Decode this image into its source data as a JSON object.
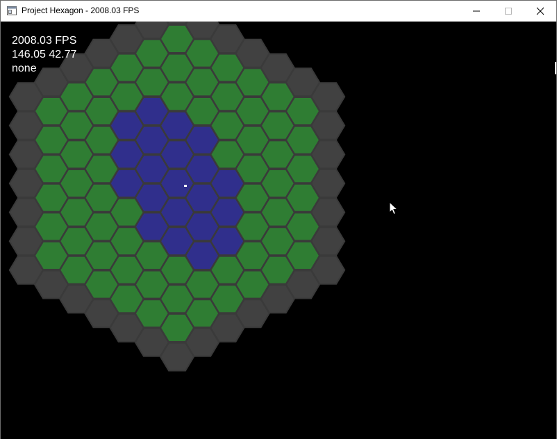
{
  "window": {
    "title": "Project Hexagon - 2008.03 FPS",
    "icon": "app-window-icon",
    "controls": [
      "minimize-icon",
      "maximize-icon",
      "close-icon"
    ]
  },
  "hud": {
    "fps": "2008.03 FPS",
    "coords": "146.05 42.77",
    "selection": "none"
  },
  "colors": {
    "background": "#000000",
    "hex_stroke": "#3a3a3a",
    "wall": "#414141",
    "grass": "#2f7d33",
    "water": "#302f8c",
    "hud_text": "#ffffff"
  },
  "map": {
    "radius": 6,
    "tile_types": [
      "wall",
      "grass",
      "water"
    ],
    "water_tiles": [
      [
        0,
        0
      ],
      [
        1,
        0
      ],
      [
        -1,
        0
      ],
      [
        2,
        0
      ],
      [
        -2,
        0
      ],
      [
        0,
        1
      ],
      [
        1,
        1
      ],
      [
        2,
        1
      ],
      [
        -1,
        1
      ],
      [
        -2,
        1
      ],
      [
        0,
        -1
      ],
      [
        1,
        -1
      ],
      [
        -1,
        -1
      ],
      [
        -2,
        -1
      ],
      [
        2,
        -1
      ],
      [
        0,
        -2
      ],
      [
        1,
        -2
      ],
      [
        -1,
        -2
      ],
      [
        0,
        2
      ],
      [
        1,
        2
      ],
      [
        -1,
        2
      ]
    ]
  }
}
